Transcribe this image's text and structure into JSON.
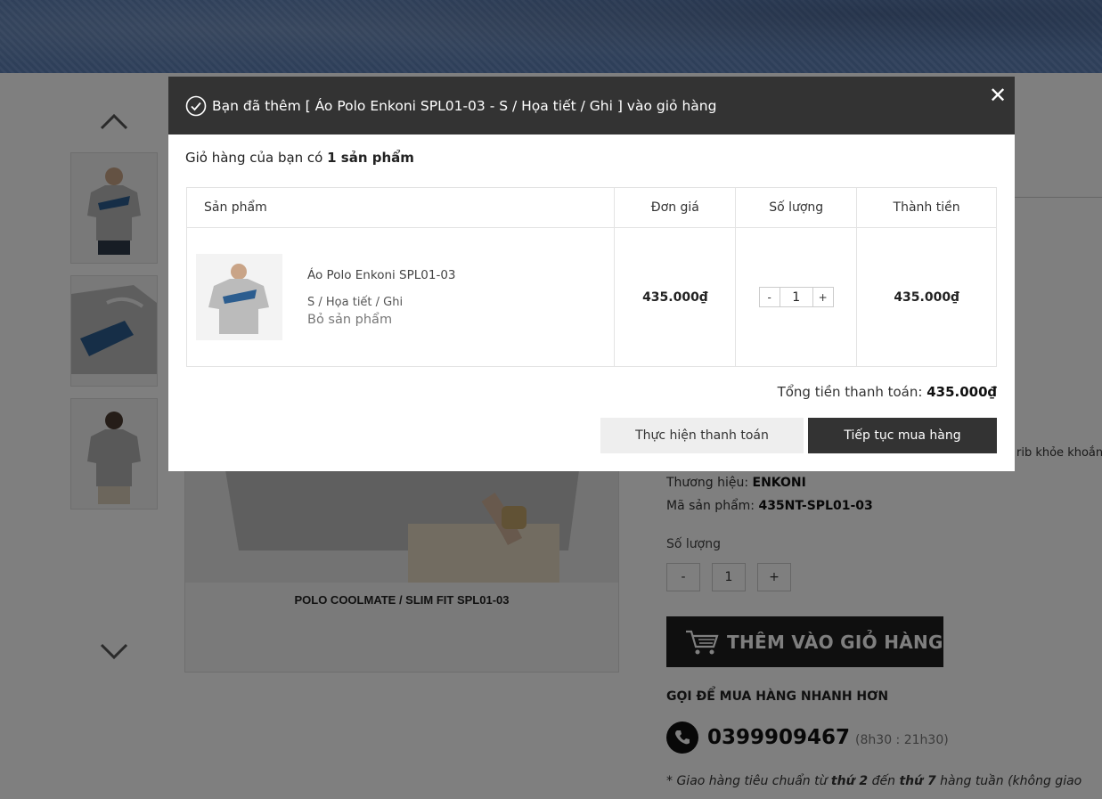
{
  "modal": {
    "header_text": "Bạn đã thêm [ Áo Polo Enkoni SPL01-03 - S / Họa tiết / Ghi ] vào giỏ hàng",
    "close_symbol": "✕",
    "cart_count_prefix": "Giỏ hàng của bạn có",
    "cart_count_value": "1 sản phẩm",
    "table_headers": {
      "product": "Sản phẩm",
      "unit_price": "Đơn giá",
      "quantity": "Số lượng",
      "line_total": "Thành tiền"
    },
    "item": {
      "name": "Áo Polo Enkoni SPL01-03",
      "variant": "S / Họa tiết / Ghi",
      "remove_label": "Bỏ sản phẩm",
      "unit_price": "435.000₫",
      "quantity": "1",
      "line_total": "435.000₫",
      "qty_minus": "-",
      "qty_plus": "+"
    },
    "grand_total_label": "Tổng tiền thanh toán:",
    "grand_total_value": "435.000₫",
    "checkout_button": "Thực hiện thanh toán",
    "continue_button": "Tiếp tục mua hàng"
  },
  "page": {
    "main_caption": "POLO COOLMATE   /  SLIM FIT SPL01-03",
    "description_tail": "rib khỏe khoắn",
    "brand_label": "Thương hiệu:",
    "brand_value": "ENKONI",
    "sku_label": "Mã sản phẩm:",
    "sku_value": "435NT-SPL01-03",
    "quantity_label": "Số lượng",
    "qty_minus": "-",
    "qty_value": "1",
    "qty_plus": "+",
    "add_to_cart": "THÊM VÀO GIỎ HÀNG",
    "call_title": "GỌI ĐỂ MUA HÀNG NHANH HƠN",
    "phone_number": "0399909467",
    "phone_hours": "(8h30 : 21h30)",
    "ship_note_1": "* Giao hàng tiêu chuẩn từ",
    "ship_note_day1": "thứ 2",
    "ship_note_2": "đến",
    "ship_note_day2": "thứ 7",
    "ship_note_3": "hàng tuần (không giao"
  },
  "icons": {
    "check": "check-circle-icon",
    "close": "close-icon",
    "arrow_up": "chevron-up-icon",
    "arrow_down": "chevron-down-icon",
    "cart": "cart-icon",
    "phone": "phone-icon"
  },
  "colors": {
    "header_bg": "#333333",
    "primary_button": "#333333",
    "secondary_button": "#eeeeee",
    "add_to_cart_bg": "#1e1e1e"
  }
}
